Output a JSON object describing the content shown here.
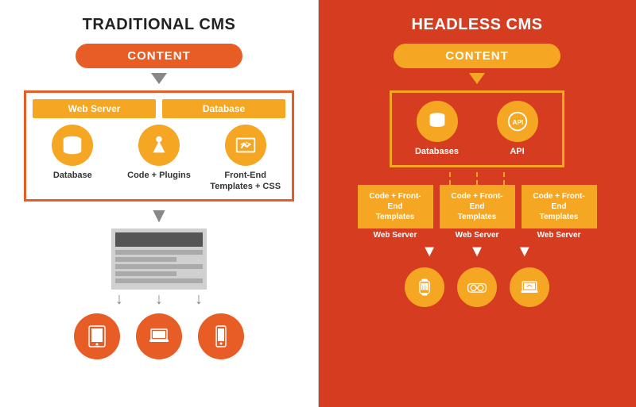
{
  "left": {
    "title": "TRADITIONAL CMS",
    "content_label": "CONTENT",
    "web_server_label": "Web Server",
    "database_label": "Database",
    "icons": [
      {
        "label": "Database"
      },
      {
        "label": "Code + Plugins"
      },
      {
        "label": "Front-End\nTemplates + CSS"
      }
    ],
    "devices": [
      "tablet",
      "laptop",
      "phone"
    ]
  },
  "right": {
    "title": "HEADLESS CMS",
    "content_label": "CONTENT",
    "icons": [
      {
        "label": "Databases"
      },
      {
        "label": "API"
      }
    ],
    "server_boxes": [
      {
        "code_label": "Code + Front-End Templates",
        "web_label": "Web Server"
      },
      {
        "code_label": "Code + Front-End Templates",
        "web_label": "Web Server"
      },
      {
        "code_label": "Code + Front-End Templates",
        "web_label": "Web Server"
      }
    ],
    "devices": [
      "smartwatch",
      "vr-glasses",
      "laptop"
    ]
  }
}
